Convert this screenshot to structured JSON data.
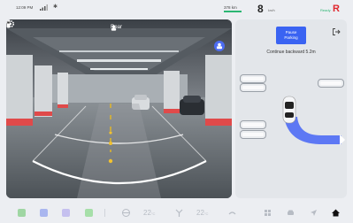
{
  "status_bar": {
    "time": "12:09 PM",
    "range": "378 km",
    "speed": "8",
    "speed_unit": "km/h",
    "ready": "Ready",
    "gear": "R"
  },
  "camera": {
    "label": "Rear"
  },
  "parking_panel": {
    "pause_label_line1": "Pause",
    "pause_label_line2": "Parking",
    "instruction": "Continue backward 5.2m"
  },
  "dock": {
    "temp_left": "22",
    "temp_left_unit": "°C",
    "temp_right": "22",
    "temp_right_unit": "°C"
  },
  "colors": {
    "accent": "#3a63f2",
    "gear": "#e0262d",
    "ready": "#2bb673",
    "path": "#4e6cf5"
  }
}
